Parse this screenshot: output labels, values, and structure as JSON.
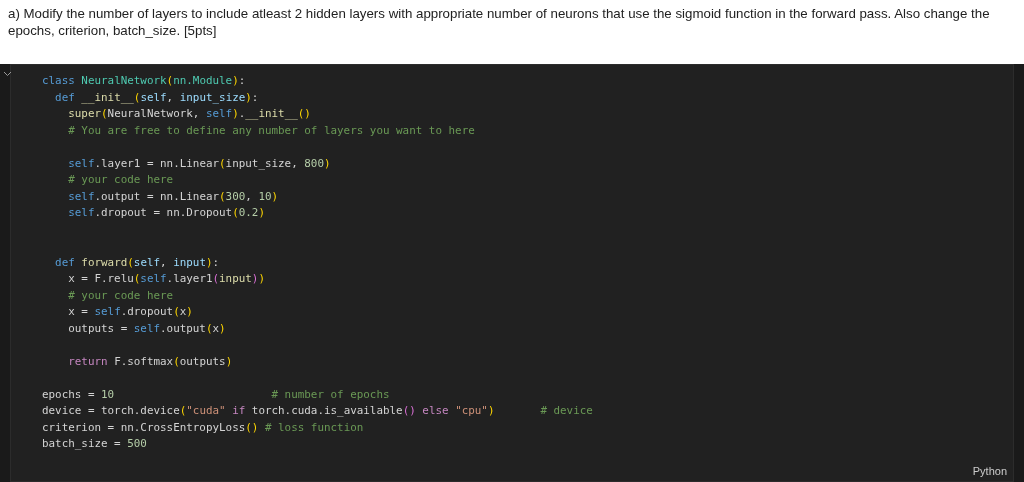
{
  "question": {
    "text": "a) Modify the number of layers to include atleast 2 hidden layers with appropriate number of neurons that use the sigmoid function in the forward pass. Also change the epochs, criterion, batch_size. [5pts]"
  },
  "cell": {
    "expanded": true,
    "language": "Python",
    "lines": [
      {
        "kind": "code",
        "segments": [
          {
            "kind": "kw",
            "text": "class"
          },
          {
            "kind": "cls",
            "text": " NeuralNetwork"
          },
          {
            "kind": "b1",
            "text": "("
          },
          {
            "kind": "cls",
            "text": "nn.Module"
          },
          {
            "kind": "b1",
            "text": ")"
          },
          {
            "kind": "p",
            "text": ":"
          }
        ]
      },
      {
        "kind": "code",
        "segments": [
          {
            "kind": "kw",
            "text": "  def"
          },
          {
            "kind": "fn",
            "text": " __init__"
          },
          {
            "kind": "b1",
            "text": "("
          },
          {
            "kind": "par",
            "text": "self"
          },
          {
            "kind": "p",
            "text": ","
          },
          {
            "kind": "par",
            "text": " input_size"
          },
          {
            "kind": "b1",
            "text": ")"
          },
          {
            "kind": "p",
            "text": ":"
          }
        ]
      },
      {
        "kind": "code",
        "segments": [
          {
            "kind": "fn",
            "text": "    super"
          },
          {
            "kind": "b1",
            "text": "("
          },
          {
            "kind": "p",
            "text": "NeuralNetwork,"
          },
          {
            "kind": "kw",
            "text": " self"
          },
          {
            "kind": "b1",
            "text": ")"
          },
          {
            "kind": "p",
            "text": "."
          },
          {
            "kind": "fn",
            "text": "__init__"
          },
          {
            "kind": "b1",
            "text": "()"
          }
        ]
      },
      {
        "kind": "code",
        "segments": [
          {
            "kind": "cm",
            "text": "    # You are free to define any number of layers you want to here"
          }
        ]
      },
      {
        "kind": "blank"
      },
      {
        "kind": "code",
        "segments": [
          {
            "kind": "kw",
            "text": "    self"
          },
          {
            "kind": "p",
            "text": ".layer1 = nn.Linear"
          },
          {
            "kind": "b1",
            "text": "("
          },
          {
            "kind": "p",
            "text": "input_size,"
          },
          {
            "kind": "num",
            "text": " 800"
          },
          {
            "kind": "b1",
            "text": ")"
          }
        ]
      },
      {
        "kind": "code",
        "segments": [
          {
            "kind": "cm",
            "text": "    # your code here"
          }
        ]
      },
      {
        "kind": "code",
        "segments": [
          {
            "kind": "kw",
            "text": "    self"
          },
          {
            "kind": "p",
            "text": ".output = nn.Linear"
          },
          {
            "kind": "b1",
            "text": "("
          },
          {
            "kind": "num",
            "text": "300"
          },
          {
            "kind": "p",
            "text": ","
          },
          {
            "kind": "num",
            "text": " 10"
          },
          {
            "kind": "b1",
            "text": ")"
          }
        ]
      },
      {
        "kind": "code",
        "segments": [
          {
            "kind": "kw",
            "text": "    self"
          },
          {
            "kind": "p",
            "text": ".dropout = nn.Dropout"
          },
          {
            "kind": "b1",
            "text": "("
          },
          {
            "kind": "num",
            "text": "0.2"
          },
          {
            "kind": "b1",
            "text": ")"
          }
        ]
      },
      {
        "kind": "blank"
      },
      {
        "kind": "blank"
      },
      {
        "kind": "code",
        "segments": [
          {
            "kind": "kw",
            "text": "  def"
          },
          {
            "kind": "fn",
            "text": " forward"
          },
          {
            "kind": "b1",
            "text": "("
          },
          {
            "kind": "par",
            "text": "self"
          },
          {
            "kind": "p",
            "text": ","
          },
          {
            "kind": "par",
            "text": " input"
          },
          {
            "kind": "b1",
            "text": ")"
          },
          {
            "kind": "p",
            "text": ":"
          }
        ]
      },
      {
        "kind": "code",
        "segments": [
          {
            "kind": "p",
            "text": "    x = F.relu"
          },
          {
            "kind": "b1",
            "text": "("
          },
          {
            "kind": "kw",
            "text": "self"
          },
          {
            "kind": "p",
            "text": ".layer1"
          },
          {
            "kind": "b2",
            "text": "("
          },
          {
            "kind": "fn",
            "text": "input"
          },
          {
            "kind": "b2",
            "text": ")"
          },
          {
            "kind": "b1",
            "text": ")"
          }
        ]
      },
      {
        "kind": "code",
        "segments": [
          {
            "kind": "cm",
            "text": "    # your code here"
          }
        ]
      },
      {
        "kind": "code",
        "segments": [
          {
            "kind": "p",
            "text": "    x = "
          },
          {
            "kind": "kw",
            "text": "self"
          },
          {
            "kind": "p",
            "text": ".dropout"
          },
          {
            "kind": "b1",
            "text": "("
          },
          {
            "kind": "p",
            "text": "x"
          },
          {
            "kind": "b1",
            "text": ")"
          }
        ]
      },
      {
        "kind": "code",
        "segments": [
          {
            "kind": "p",
            "text": "    outputs = "
          },
          {
            "kind": "kw",
            "text": "self"
          },
          {
            "kind": "p",
            "text": ".output"
          },
          {
            "kind": "b1",
            "text": "("
          },
          {
            "kind": "p",
            "text": "x"
          },
          {
            "kind": "b1",
            "text": ")"
          }
        ]
      },
      {
        "kind": "blank"
      },
      {
        "kind": "code",
        "segments": [
          {
            "kind": "ctl",
            "text": "    return"
          },
          {
            "kind": "p",
            "text": " F.softmax"
          },
          {
            "kind": "b1",
            "text": "("
          },
          {
            "kind": "p",
            "text": "outputs"
          },
          {
            "kind": "b1",
            "text": ")"
          }
        ]
      },
      {
        "kind": "blank"
      },
      {
        "kind": "code",
        "segments": [
          {
            "kind": "p",
            "text": "epochs = "
          },
          {
            "kind": "num",
            "text": "10"
          },
          {
            "kind": "cm",
            "text": "                        # number of epochs"
          }
        ]
      },
      {
        "kind": "code",
        "segments": [
          {
            "kind": "p",
            "text": "device = torch.device"
          },
          {
            "kind": "b1",
            "text": "("
          },
          {
            "kind": "str",
            "text": "\"cuda\""
          },
          {
            "kind": "ctl",
            "text": " if"
          },
          {
            "kind": "p",
            "text": " torch.cuda.is_available"
          },
          {
            "kind": "b2",
            "text": "()"
          },
          {
            "kind": "ctl",
            "text": " else"
          },
          {
            "kind": "str",
            "text": " \"cpu\""
          },
          {
            "kind": "b1",
            "text": ")"
          },
          {
            "kind": "cm",
            "text": "       # device"
          }
        ]
      },
      {
        "kind": "code",
        "segments": [
          {
            "kind": "p",
            "text": "criterion = nn.CrossEntropyLoss"
          },
          {
            "kind": "b1",
            "text": "()"
          },
          {
            "kind": "cm",
            "text": " # loss function"
          }
        ]
      },
      {
        "kind": "code",
        "segments": [
          {
            "kind": "p",
            "text": "batch_size = "
          },
          {
            "kind": "num",
            "text": "500"
          }
        ]
      }
    ]
  }
}
